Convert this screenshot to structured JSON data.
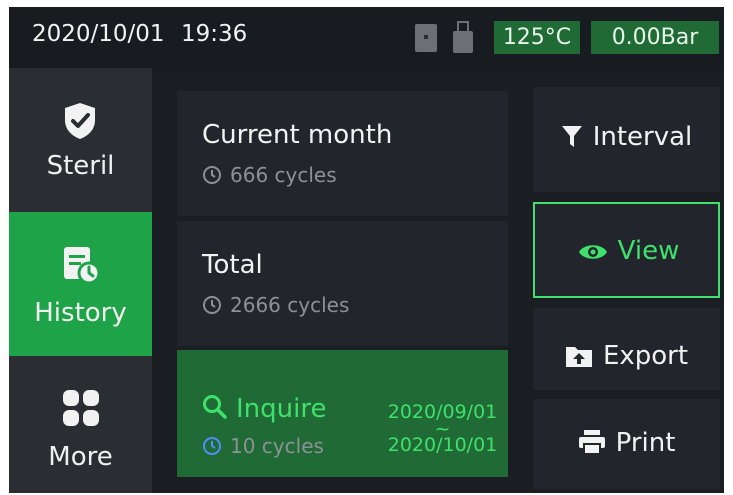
{
  "status_bar": {
    "date": "2020/10/01",
    "time": "19:36",
    "temperature": "125°C",
    "pressure": "0.00Bar",
    "icons": [
      "sd-card-icon",
      "usb-icon"
    ]
  },
  "nav": {
    "items": [
      {
        "label": "Steril",
        "icon": "shield-check-icon",
        "active": false
      },
      {
        "label": "History",
        "icon": "history-clock-document-icon",
        "active": true
      },
      {
        "label": "More",
        "icon": "grid-icon",
        "active": false
      }
    ]
  },
  "cards": {
    "current_month": {
      "title": "Current month",
      "cycles": "666 cycles"
    },
    "total": {
      "title": "Total",
      "cycles": "2666 cycles"
    },
    "inquire": {
      "title": "Inquire",
      "cycles": "10 cycles",
      "range_from": "2020/09/01",
      "range_sep": "~",
      "range_to": "2020/10/01"
    }
  },
  "actions": {
    "interval": "Interval",
    "view": "View",
    "export": "Export",
    "print": "Print"
  },
  "colors": {
    "accent_green": "#1fa348",
    "active_text_green": "#3fe06b",
    "badge_green": "#1f6a35",
    "background": "#1a1d22"
  }
}
